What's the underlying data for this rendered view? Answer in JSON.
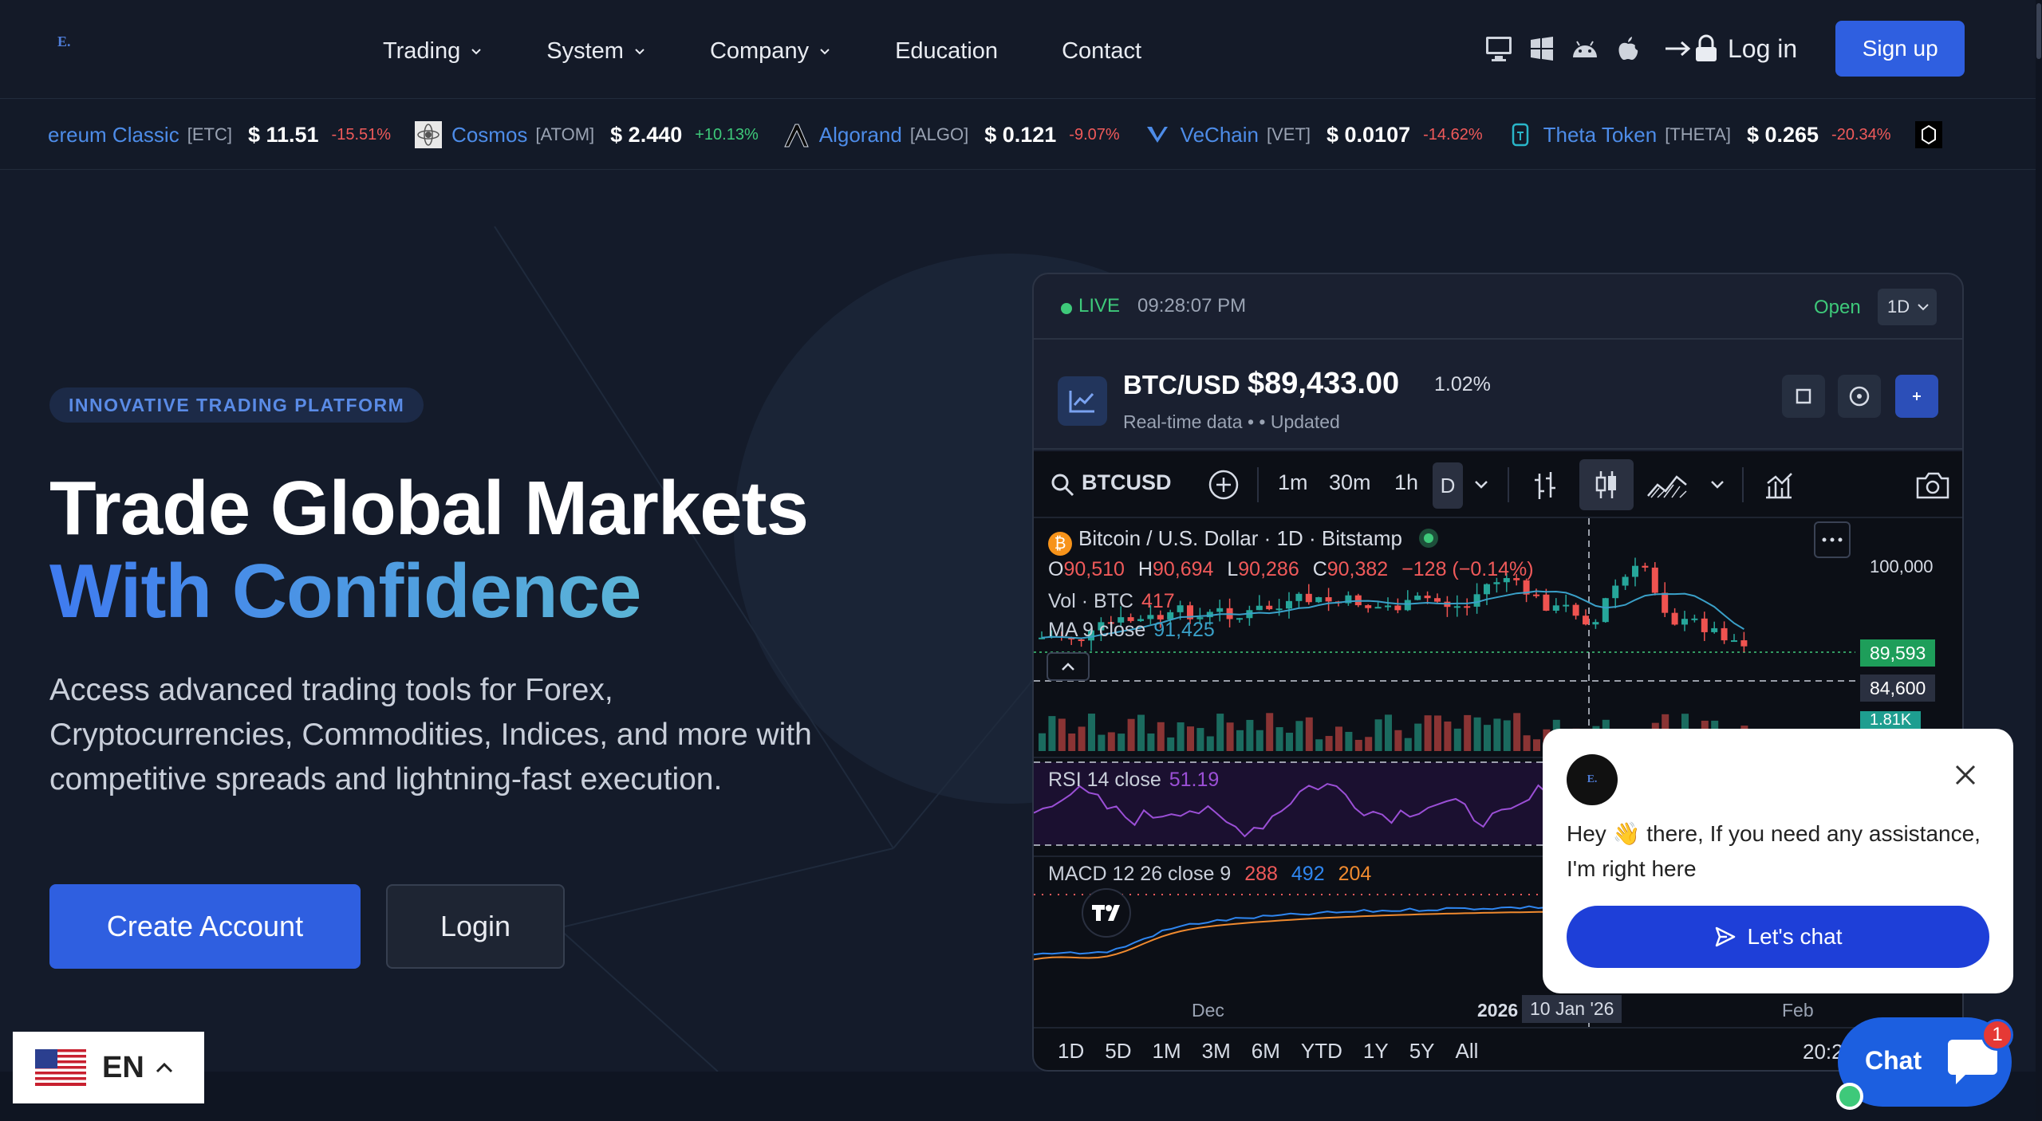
{
  "brand": {
    "logo_text": "E."
  },
  "nav": {
    "items": [
      {
        "label": "Trading",
        "has_dropdown": true
      },
      {
        "label": "System",
        "has_dropdown": true
      },
      {
        "label": "Company",
        "has_dropdown": true
      },
      {
        "label": "Education",
        "has_dropdown": false
      },
      {
        "label": "Contact",
        "has_dropdown": false
      }
    ],
    "platform_icons": [
      "desktop-icon",
      "windows-icon",
      "android-icon",
      "apple-icon"
    ],
    "login_label": "Log in",
    "signup_label": "Sign up"
  },
  "ticker": [
    {
      "name": "ereum Classic",
      "symbol": "[ETC]",
      "price": "$ 11.51",
      "change": "-15.51%",
      "dir": "neg",
      "icon": "ethereum-classic-icon"
    },
    {
      "name": "Cosmos",
      "symbol": "[ATOM]",
      "price": "$ 2.440",
      "change": "+10.13%",
      "dir": "pos",
      "icon": "cosmos-icon"
    },
    {
      "name": "Algorand",
      "symbol": "[ALGO]",
      "price": "$ 0.121",
      "change": "-9.07%",
      "dir": "neg",
      "icon": "algorand-icon"
    },
    {
      "name": "VeChain",
      "symbol": "[VET]",
      "price": "$ 0.0107",
      "change": "-14.62%",
      "dir": "neg",
      "icon": "vechain-icon"
    },
    {
      "name": "Theta Token",
      "symbol": "[THETA]",
      "price": "$ 0.265",
      "change": "-20.34%",
      "dir": "neg",
      "icon": "theta-icon"
    }
  ],
  "hero": {
    "badge": "INNOVATIVE TRADING PLATFORM",
    "title_line1": "Trade Global Markets",
    "title_line2": "With Confidence",
    "subtitle": "Access advanced trading tools for Forex, Cryptocurrencies, Commodities, Indices, and more with competitive spreads and lightning-fast execution.",
    "cta_primary": "Create Account",
    "cta_secondary": "Login"
  },
  "widget": {
    "live_label": "LIVE",
    "time": "09:28:07 PM",
    "status": "Open",
    "timeframe": "1D",
    "pair": "BTC/USD",
    "price": "$89,433.00",
    "change_pct": "1.02%",
    "realtime_text": "Real-time data •  • Updated",
    "chart": {
      "symbol": "BTCUSD",
      "intervals": [
        "1m",
        "30m",
        "1h",
        "D"
      ],
      "active_interval": "D",
      "title": "Bitcoin / U.S. Dollar · 1D · Bitstamp",
      "ohlc": {
        "O": "90,510",
        "H": "90,694",
        "L": "90,286",
        "C": "90,382",
        "change": "−128 (−0.14%)"
      },
      "vol_label": "Vol · BTC",
      "vol_value": "417",
      "ma_label": "MA 9 close",
      "ma_value": "91,425",
      "rsi_label": "RSI 14 close",
      "rsi_value": "51.19",
      "macd_label": "MACD 12 26 close 9",
      "macd_values": [
        "288",
        "492",
        "204"
      ],
      "price_axis_top": "100,000",
      "last_price": "89,593",
      "crosshair_price": "84,600",
      "vol_badge": "1.81K",
      "time_labels": [
        "Dec",
        "2026",
        "10 Jan '26",
        "Feb"
      ],
      "ranges": [
        "1D",
        "5D",
        "1M",
        "3M",
        "6M",
        "YTD",
        "1Y",
        "5Y",
        "All"
      ],
      "clock": "20:2"
    }
  },
  "language": {
    "code": "EN"
  },
  "chat": {
    "greeting_pre": "Hey",
    "greeting_emoji": "👋",
    "greeting_post": "there, If you need any assistance, I'm right here",
    "button_label": "Let's chat",
    "fab_label": "Chat",
    "unread": "1"
  },
  "colors": {
    "accent": "#2f5fe0",
    "positive": "#3ec97a",
    "negative": "#f05a5a",
    "background": "#141b2a"
  }
}
